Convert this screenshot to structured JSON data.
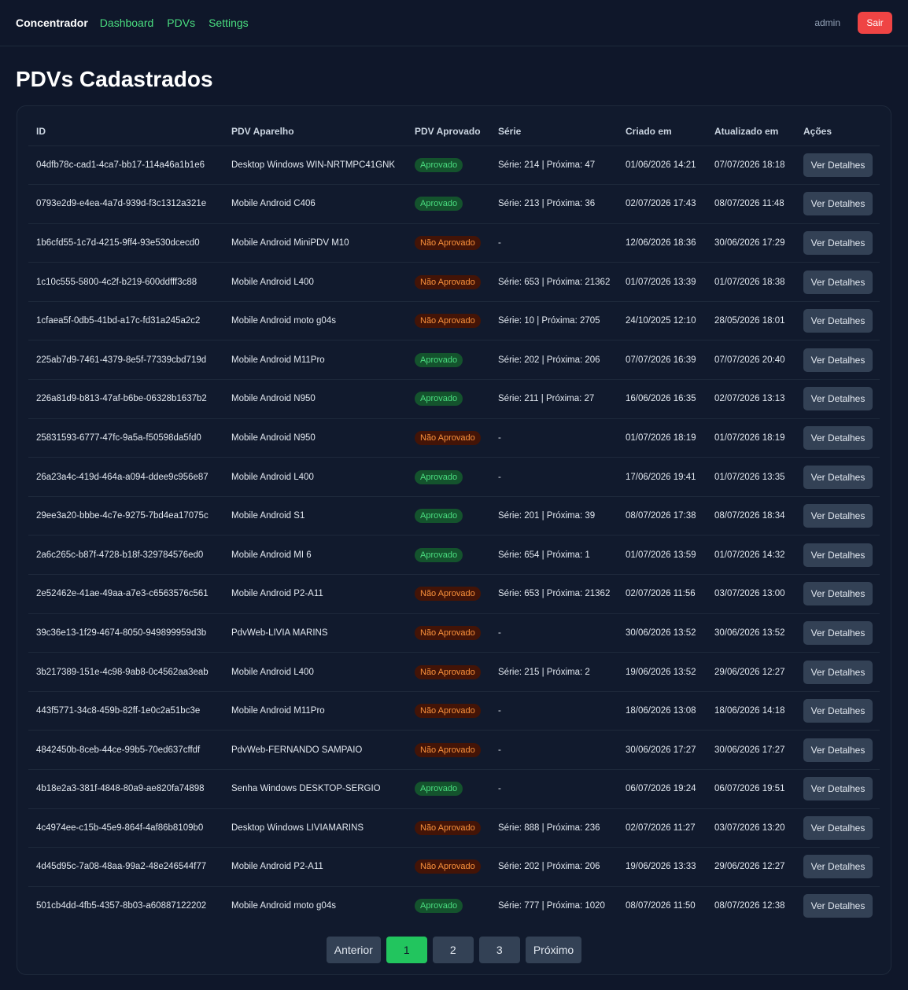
{
  "nav": {
    "brand": "Concentrador",
    "links": [
      "Dashboard",
      "PDVs",
      "Settings"
    ],
    "user": "admin",
    "logout_label": "Sair"
  },
  "page": {
    "title": "PDVs Cadastrados"
  },
  "table": {
    "headers": [
      "ID",
      "PDV Aparelho",
      "PDV Aprovado",
      "Série",
      "Criado em",
      "Atualizado em",
      "Ações"
    ],
    "action_label": "Ver Detalhes",
    "rows": [
      {
        "id": "04dfb78c-cad1-4ca7-bb17-114a46a1b1e6",
        "device": "Desktop Windows WIN-NRTMPC41GNK",
        "status": "Aprovado",
        "approved": true,
        "serie": "Série: 214 | Próxima: 47",
        "created": "01/06/2026 14:21",
        "updated": "07/07/2026 18:18"
      },
      {
        "id": "0793e2d9-e4ea-4a7d-939d-f3c1312a321e",
        "device": "Mobile Android C406",
        "status": "Aprovado",
        "approved": true,
        "serie": "Série: 213 | Próxima: 36",
        "created": "02/07/2026 17:43",
        "updated": "08/07/2026 11:48"
      },
      {
        "id": "1b6cfd55-1c7d-4215-9ff4-93e530dcecd0",
        "device": "Mobile Android MiniPDV M10",
        "status": "Não Aprovado",
        "approved": false,
        "serie": "-",
        "created": "12/06/2026 18:36",
        "updated": "30/06/2026 17:29"
      },
      {
        "id": "1c10c555-5800-4c2f-b219-600ddfff3c88",
        "device": "Mobile Android L400",
        "status": "Não Aprovado",
        "approved": false,
        "serie": "Série: 653 | Próxima: 21362",
        "created": "01/07/2026 13:39",
        "updated": "01/07/2026 18:38"
      },
      {
        "id": "1cfaea5f-0db5-41bd-a17c-fd31a245a2c2",
        "device": "Mobile Android moto g04s",
        "status": "Não Aprovado",
        "approved": false,
        "serie": "Série: 10 | Próxima: 2705",
        "created": "24/10/2025 12:10",
        "updated": "28/05/2026 18:01"
      },
      {
        "id": "225ab7d9-7461-4379-8e5f-77339cbd719d",
        "device": "Mobile Android M11Pro",
        "status": "Aprovado",
        "approved": true,
        "serie": "Série: 202 | Próxima: 206",
        "created": "07/07/2026 16:39",
        "updated": "07/07/2026 20:40"
      },
      {
        "id": "226a81d9-b813-47af-b6be-06328b1637b2",
        "device": "Mobile Android N950",
        "status": "Aprovado",
        "approved": true,
        "serie": "Série: 211 | Próxima: 27",
        "created": "16/06/2026 16:35",
        "updated": "02/07/2026 13:13"
      },
      {
        "id": "25831593-6777-47fc-9a5a-f50598da5fd0",
        "device": "Mobile Android N950",
        "status": "Não Aprovado",
        "approved": false,
        "serie": "-",
        "created": "01/07/2026 18:19",
        "updated": "01/07/2026 18:19"
      },
      {
        "id": "26a23a4c-419d-464a-a094-ddee9c956e87",
        "device": "Mobile Android L400",
        "status": "Aprovado",
        "approved": true,
        "serie": "-",
        "created": "17/06/2026 19:41",
        "updated": "01/07/2026 13:35"
      },
      {
        "id": "29ee3a20-bbbe-4c7e-9275-7bd4ea17075c",
        "device": "Mobile Android S1",
        "status": "Aprovado",
        "approved": true,
        "serie": "Série: 201 | Próxima: 39",
        "created": "08/07/2026 17:38",
        "updated": "08/07/2026 18:34"
      },
      {
        "id": "2a6c265c-b87f-4728-b18f-329784576ed0",
        "device": "Mobile Android MI 6",
        "status": "Aprovado",
        "approved": true,
        "serie": "Série: 654 | Próxima: 1",
        "created": "01/07/2026 13:59",
        "updated": "01/07/2026 14:32"
      },
      {
        "id": "2e52462e-41ae-49aa-a7e3-c6563576c561",
        "device": "Mobile Android P2-A11",
        "status": "Não Aprovado",
        "approved": false,
        "serie": "Série: 653 | Próxima: 21362",
        "created": "02/07/2026 11:56",
        "updated": "03/07/2026 13:00"
      },
      {
        "id": "39c36e13-1f29-4674-8050-949899959d3b",
        "device": "PdvWeb-LIVIA MARINS",
        "status": "Não Aprovado",
        "approved": false,
        "serie": "-",
        "created": "30/06/2026 13:52",
        "updated": "30/06/2026 13:52"
      },
      {
        "id": "3b217389-151e-4c98-9ab8-0c4562aa3eab",
        "device": "Mobile Android L400",
        "status": "Não Aprovado",
        "approved": false,
        "serie": "Série: 215 | Próxima: 2",
        "created": "19/06/2026 13:52",
        "updated": "29/06/2026 12:27"
      },
      {
        "id": "443f5771-34c8-459b-82ff-1e0c2a51bc3e",
        "device": "Mobile Android M11Pro",
        "status": "Não Aprovado",
        "approved": false,
        "serie": "-",
        "created": "18/06/2026 13:08",
        "updated": "18/06/2026 14:18"
      },
      {
        "id": "4842450b-8ceb-44ce-99b5-70ed637cffdf",
        "device": "PdvWeb-FERNANDO SAMPAIO",
        "status": "Não Aprovado",
        "approved": false,
        "serie": "-",
        "created": "30/06/2026 17:27",
        "updated": "30/06/2026 17:27"
      },
      {
        "id": "4b18e2a3-381f-4848-80a9-ae820fa74898",
        "device": "Senha Windows DESKTOP-SERGIO",
        "status": "Aprovado",
        "approved": true,
        "serie": "-",
        "created": "06/07/2026 19:24",
        "updated": "06/07/2026 19:51"
      },
      {
        "id": "4c4974ee-c15b-45e9-864f-4af86b8109b0",
        "device": "Desktop Windows LIVIAMARINS",
        "status": "Não Aprovado",
        "approved": false,
        "serie": "Série: 888 | Próxima: 236",
        "created": "02/07/2026 11:27",
        "updated": "03/07/2026 13:20"
      },
      {
        "id": "4d45d95c-7a08-48aa-99a2-48e246544f77",
        "device": "Mobile Android P2-A11",
        "status": "Não Aprovado",
        "approved": false,
        "serie": "Série: 202 | Próxima: 206",
        "created": "19/06/2026 13:33",
        "updated": "29/06/2026 12:27"
      },
      {
        "id": "501cb4dd-4fb5-4357-8b03-a60887122202",
        "device": "Mobile Android moto g04s",
        "status": "Aprovado",
        "approved": true,
        "serie": "Série: 777 | Próxima: 1020",
        "created": "08/07/2026 11:50",
        "updated": "08/07/2026 12:38"
      }
    ]
  },
  "pagination": {
    "prev_label": "Anterior",
    "next_label": "Próximo",
    "pages": [
      "1",
      "2",
      "3"
    ],
    "current": "1"
  },
  "colors": {
    "accent": "#4ade80",
    "danger": "#ef4444",
    "approved": "#4ade80",
    "not_approved": "#fb923c"
  }
}
